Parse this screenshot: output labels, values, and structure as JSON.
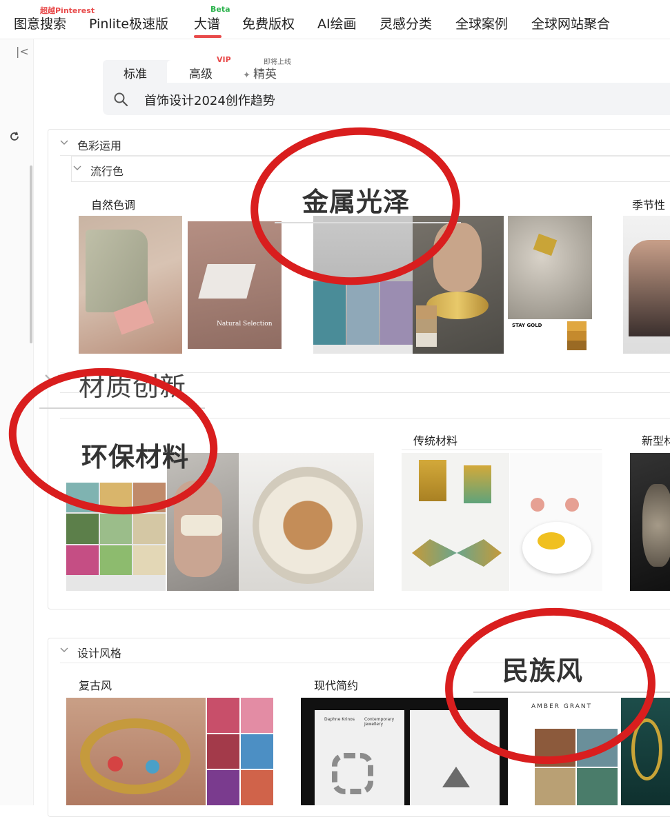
{
  "nav": {
    "items": [
      {
        "label": "图意搜索"
      },
      {
        "label": "Pinlite极速版"
      },
      {
        "label": "大谱"
      },
      {
        "label": "免费版权"
      },
      {
        "label": "AI绘画"
      },
      {
        "label": "灵感分类"
      },
      {
        "label": "全球案例"
      },
      {
        "label": "全球网站聚合"
      }
    ],
    "badge_pinterest": "超越Pinterest",
    "badge_beta": "Beta",
    "active_index": 2,
    "accent": "#e84a4a"
  },
  "search": {
    "tabs": [
      {
        "label": "标准"
      },
      {
        "label": "高级"
      },
      {
        "label": "精英"
      }
    ],
    "vip_badge": "VIP",
    "soon_badge": "即将上线",
    "query": "首饰设计2024创作趋势"
  },
  "sections": {
    "color": {
      "title": "色彩运用",
      "sub_title": "流行色",
      "categories": [
        {
          "label": "自然色调"
        },
        {
          "label": "季节性"
        }
      ]
    },
    "material": {
      "categories": [
        {
          "label": "传统材料"
        },
        {
          "label": "新型材"
        }
      ]
    },
    "style": {
      "title": "设计风格",
      "categories": [
        {
          "label": "复古风"
        },
        {
          "label": "现代简约"
        }
      ]
    }
  },
  "annotations": {
    "metal": "金属光泽",
    "material_innovation": "材质创新",
    "eco": "环保材料",
    "ethnic": "民族风",
    "circle_color": "#d91e1e"
  },
  "image_texts": {
    "natural_selection": "Natural Selection",
    "stay_gold": "STAY GOLD",
    "designer_1": "Daphne Krinos",
    "designer_2": "Contemporary Jewellery",
    "amber": "AMBER GRANT"
  }
}
